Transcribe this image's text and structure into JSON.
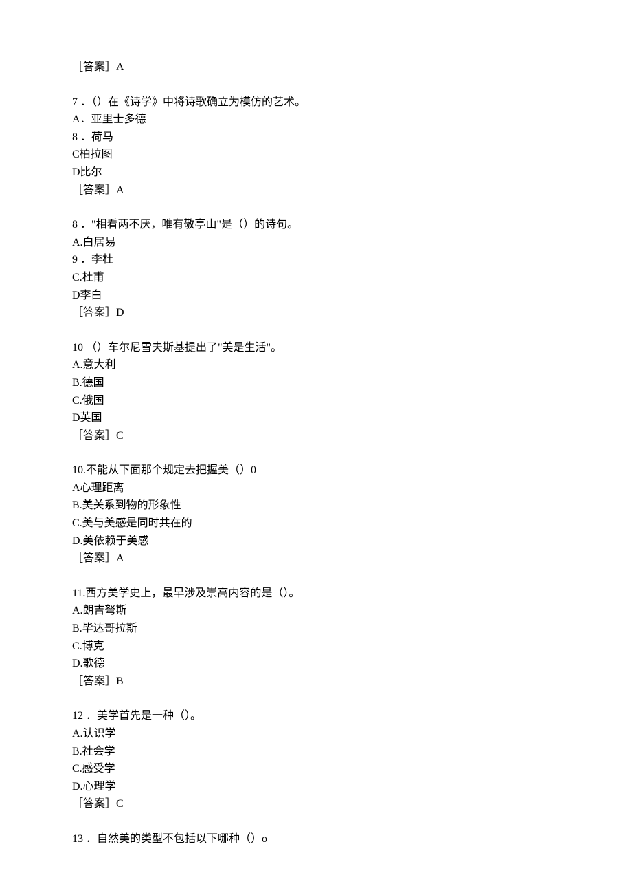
{
  "top_answer": "［答案］A",
  "questions": [
    {
      "number": "7 ．",
      "stem": "（）在《诗学》中将诗歌确立为模仿的艺术。",
      "options": [
        "A．亚里士多德",
        "8 ．荷马",
        "C柏拉图",
        "D比尔"
      ],
      "answer": "［答案］A"
    },
    {
      "number": "8 ．",
      "stem": "\"相看两不厌，唯有敬亭山\"是（）的诗句。",
      "options": [
        "A.白居易",
        "9 ．李杜",
        "C.杜甫",
        "D李白"
      ],
      "answer": "［答案］D"
    },
    {
      "number": "10 ",
      "stem": "（）车尔尼雪夫斯基提出了\"美是生活\"。",
      "options": [
        "A.意大利",
        "B.德国",
        "C.俄国",
        "D英国"
      ],
      "answer": "［答案］C"
    },
    {
      "number": "10.",
      "stem": "不能从下面那个规定去把握美（）0",
      "options": [
        "A心理距离",
        "B.美关系到物的形象性",
        "C.美与美感是同时共在的",
        "D.美依赖于美感"
      ],
      "answer": "［答案］A"
    },
    {
      "number": "11.",
      "stem": "西方美学史上，最早涉及崇高内容的是（）。",
      "options": [
        "A.朗吉弩斯",
        "B.毕达哥拉斯",
        "C.博克",
        "D.歌德"
      ],
      "answer": "［答案］B"
    },
    {
      "number": "12 ．",
      "stem": "美学首先是一种（）。",
      "options": [
        "A.认识学",
        "B.社会学",
        "C.感受学",
        "D.心理学"
      ],
      "answer": "［答案］C"
    },
    {
      "number": "13 ．",
      "stem": "自然美的类型不包括以下哪种（）o",
      "options": [],
      "answer": ""
    }
  ]
}
